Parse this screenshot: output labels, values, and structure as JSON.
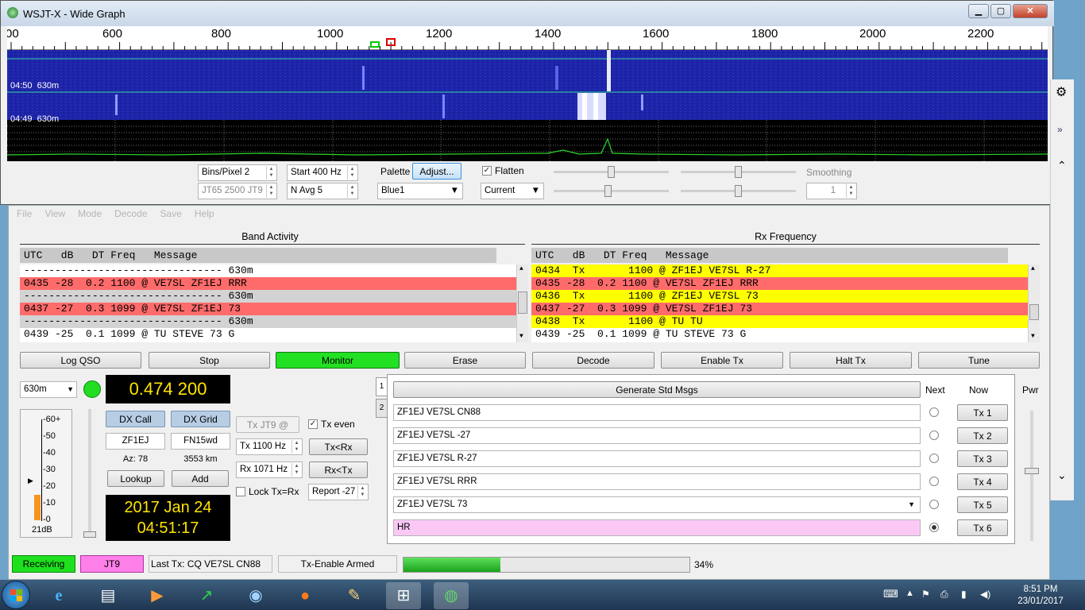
{
  "wide_graph": {
    "title": "WSJT-X - Wide Graph",
    "scale_ticks": [
      "00",
      "600",
      "800",
      "1000",
      "1200",
      "1400",
      "1600",
      "1800",
      "2000",
      "2200"
    ],
    "wf_labels": [
      "04:50  630m",
      "04:49  630m"
    ],
    "bins_pixel_label": "Bins/Pixel",
    "bins_pixel_value": "2",
    "start": "Start 400 Hz",
    "split": "JT65  2500  JT9",
    "navg": "N Avg 5",
    "palette_label": "Palette",
    "adjust_label": "Adjust...",
    "palette_value": "Blue1",
    "flatten_label": "Flatten",
    "spec_value": "Current",
    "smoothing_label": "Smoothing",
    "smoothing_value": "1"
  },
  "menu": [
    "File",
    "View",
    "Mode",
    "Decode",
    "Save",
    "Help"
  ],
  "band_activity": {
    "title": "Band Activity",
    "header": "UTC   dB   DT Freq   Message",
    "rows": [
      {
        "text": "-------------------------------- 630m",
        "color": "#ffffff"
      },
      {
        "text": "0435 -28  0.2 1100 @ VE7SL ZF1EJ RRR",
        "color": "#ff6b6b"
      },
      {
        "text": "-------------------------------- 630m",
        "color": "#d3d3d3"
      },
      {
        "text": "0437 -27  0.3 1099 @ VE7SL ZF1EJ 73",
        "color": "#ff6b6b"
      },
      {
        "text": "-------------------------------- 630m",
        "color": "#d3d3d3"
      },
      {
        "text": "0439 -25  0.1 1099 @ TU STEVE 73 G",
        "color": "#ffffff"
      }
    ]
  },
  "rx_freq": {
    "title": "Rx Frequency",
    "header": "UTC   dB   DT Freq   Message",
    "rows": [
      {
        "text": "0434  Tx       1100 @ ZF1EJ VE7SL R-27",
        "color": "#ffff00"
      },
      {
        "text": "0435 -28  0.2 1100 @ VE7SL ZF1EJ RRR",
        "color": "#ff6b6b"
      },
      {
        "text": "0436  Tx       1100 @ ZF1EJ VE7SL 73",
        "color": "#ffff00"
      },
      {
        "text": "0437 -27  0.3 1099 @ VE7SL ZF1EJ 73",
        "color": "#ff6b6b"
      },
      {
        "text": "0438  Tx       1100 @ TU TU",
        "color": "#ffff00"
      },
      {
        "text": "0439 -25  0.1 1099 @ TU STEVE 73 G",
        "color": "#ffffff"
      }
    ]
  },
  "buttons": {
    "log_qso": "Log QSO",
    "stop": "Stop",
    "monitor": "Monitor",
    "erase": "Erase",
    "decode": "Decode",
    "enable_tx": "Enable Tx",
    "halt_tx": "Halt Tx",
    "tune": "Tune"
  },
  "band": "630m",
  "frequency": "0.474 200",
  "meter": {
    "labels": [
      "60+",
      "50",
      "40",
      "30",
      "20",
      "10",
      "0"
    ],
    "level_db": "21dB",
    "level_fraction": 0.25
  },
  "dx": {
    "call_label": "DX Call",
    "grid_label": "DX Grid",
    "call": "ZF1EJ",
    "grid": "FN15wd",
    "az": "Az: 78",
    "dist": "3553 km",
    "lookup": "Lookup",
    "add": "Add"
  },
  "date": "2017 Jan 24",
  "time": "04:51:17",
  "tx_ctrl": {
    "tx_jt9": "Tx JT9  @",
    "tx_even": "Tx even",
    "tx_hz": "Tx  1100  Hz",
    "rx_hz": "Rx  1071  Hz",
    "tx_from_rx": "Tx<Rx",
    "rx_from_tx": "Rx<Tx",
    "lock": "Lock Tx=Rx",
    "report": "Report -27"
  },
  "msgs": {
    "tab1": "1",
    "tab2": "2",
    "generate": "Generate Std Msgs",
    "next": "Next",
    "now": "Now",
    "pwr": "Pwr",
    "items": [
      {
        "text": "ZF1EJ VE7SL CN88",
        "btn": "Tx 1"
      },
      {
        "text": "ZF1EJ VE7SL -27",
        "btn": "Tx 2"
      },
      {
        "text": "ZF1EJ VE7SL R-27",
        "btn": "Tx 3"
      },
      {
        "text": "ZF1EJ VE7SL RRR",
        "btn": "Tx 4"
      },
      {
        "text": "ZF1EJ VE7SL 73",
        "btn": "Tx 5"
      },
      {
        "text": "HR",
        "btn": "Tx 6"
      }
    ]
  },
  "status": {
    "receiving": "Receiving",
    "mode": "JT9",
    "last_tx": "Last Tx:  CQ VE7SL CN88",
    "armed": "Tx-Enable Armed",
    "progress": "34%",
    "progress_value": 34
  },
  "clock": {
    "time": "8:51 PM",
    "date": "23/01/2017"
  }
}
